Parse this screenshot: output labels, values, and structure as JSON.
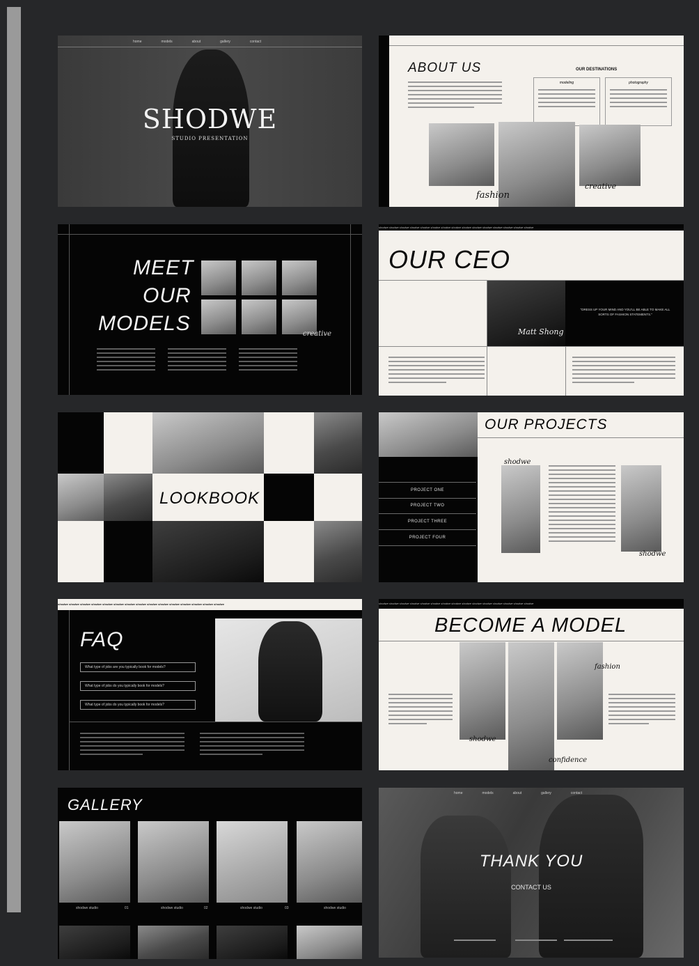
{
  "s1": {
    "nav": [
      "home",
      "models",
      "about",
      "gallery",
      "contact"
    ],
    "title": "SHODWE",
    "subtitle": "STUDIO PRESENTATION"
  },
  "s2": {
    "title": "ABOUT US",
    "dest": "OUR DESTINATIONS",
    "col1": "modeling",
    "col2": "photography",
    "script1": "fashion",
    "script2": "creative"
  },
  "s3": {
    "title_l1": "MEET",
    "title_l2": "OUR",
    "title_l3": "MODELS",
    "script": "creative"
  },
  "s4": {
    "title": "OUR CEO",
    "quote": "\"DRESS UP YOUR MIND AND YOU'LL BE ABLE TO MAKE ALL SORTS OF FASHION STATEMENTS.\"",
    "signature": "Matt Shong",
    "ticker": "shodwe shodwe shodwe shodwe shodwe shodwe shodwe shodwe shodwe shodwe shodwe shodwe shodwe shodwe shodwe"
  },
  "s5": {
    "title": "LOOKBOOK"
  },
  "s6": {
    "title": "OUR PROJECTS",
    "items": [
      "PROJECT ONE",
      "PROJECT TWO",
      "PROJECT THREE",
      "PROJECT FOUR"
    ],
    "script1": "shodwe",
    "script2": "shodwe"
  },
  "s7": {
    "title": "FAQ",
    "q1": "What type of jobs are you typically book for models?",
    "q2": "What type of jobs do you typically book for models?",
    "q3": "What type of jobs do you typically book for models?",
    "ticker": "shodwe shodwe shodwe shodwe shodwe shodwe shodwe shodwe shodwe shodwe shodwe shodwe shodwe shodwe shodwe"
  },
  "s8": {
    "title": "BECOME A MODEL",
    "script1": "fashion",
    "script2": "shodwe",
    "script3": "confidence",
    "ticker": "shodwe shodwe shodwe shodwe shodwe shodwe shodwe shodwe shodwe shodwe shodwe shodwe shodwe shodwe shodwe"
  },
  "s9": {
    "title": "GALLERY",
    "caps": [
      "shodwe studio",
      "shodwe studio",
      "shodwe studio",
      "shodwe studio"
    ],
    "nums": [
      "01",
      "02",
      "03",
      "04"
    ]
  },
  "s10": {
    "nav": [
      "home",
      "models",
      "about",
      "gallery",
      "contact"
    ],
    "title": "THANK YOU",
    "contact": "CONTACT US"
  }
}
